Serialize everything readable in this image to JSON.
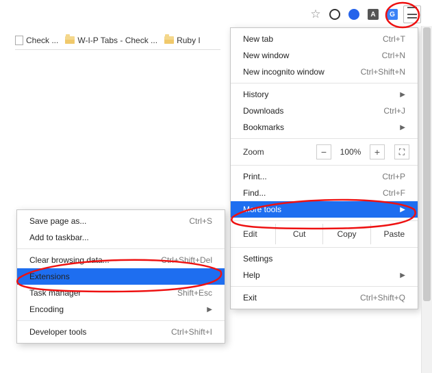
{
  "toolbar": {
    "extensions": [
      "O",
      "O",
      "A",
      "G"
    ]
  },
  "bookmarks": [
    {
      "label": "Check ..."
    },
    {
      "label": "W-I-P Tabs - Check ..."
    },
    {
      "label": "Ruby I"
    }
  ],
  "menu": {
    "new_tab": {
      "label": "New tab",
      "shortcut": "Ctrl+T"
    },
    "new_window": {
      "label": "New window",
      "shortcut": "Ctrl+N"
    },
    "incognito": {
      "label": "New incognito window",
      "shortcut": "Ctrl+Shift+N"
    },
    "history": {
      "label": "History"
    },
    "downloads": {
      "label": "Downloads",
      "shortcut": "Ctrl+J"
    },
    "bookmarks": {
      "label": "Bookmarks"
    },
    "zoom_label": "Zoom",
    "zoom_value": "100%",
    "print": {
      "label": "Print...",
      "shortcut": "Ctrl+P"
    },
    "find": {
      "label": "Find...",
      "shortcut": "Ctrl+F"
    },
    "more_tools": {
      "label": "More tools"
    },
    "edit_label": "Edit",
    "cut": "Cut",
    "copy": "Copy",
    "paste": "Paste",
    "settings": {
      "label": "Settings"
    },
    "help": {
      "label": "Help"
    },
    "exit": {
      "label": "Exit",
      "shortcut": "Ctrl+Shift+Q"
    }
  },
  "submenu": {
    "save_page": {
      "label": "Save page as...",
      "shortcut": "Ctrl+S"
    },
    "add_taskbar": {
      "label": "Add to taskbar..."
    },
    "clear_data": {
      "label": "Clear browsing data...",
      "shortcut": "Ctrl+Shift+Del"
    },
    "extensions": {
      "label": "Extensions"
    },
    "task_manager": {
      "label": "Task manager",
      "shortcut": "Shift+Esc"
    },
    "encoding": {
      "label": "Encoding"
    },
    "dev_tools": {
      "label": "Developer tools",
      "shortcut": "Ctrl+Shift+I"
    }
  }
}
